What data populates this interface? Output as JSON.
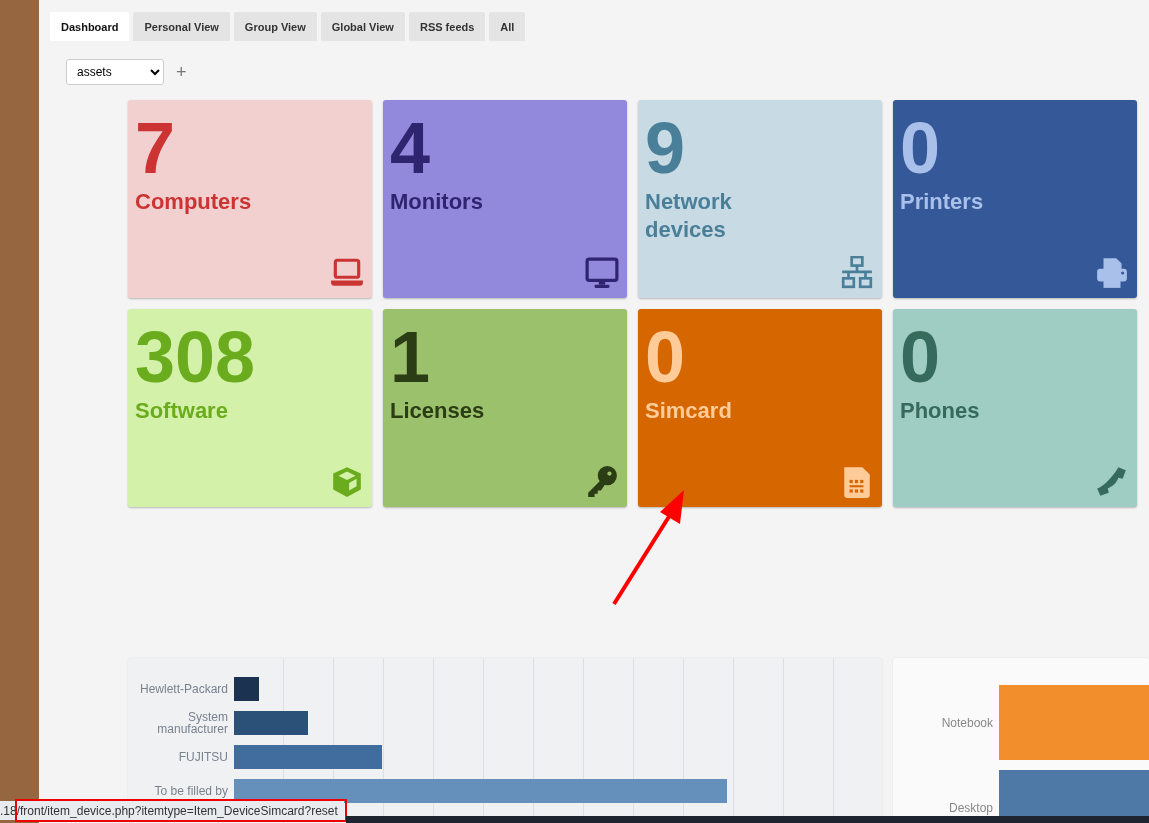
{
  "tabs": [
    {
      "label": "Dashboard",
      "selected": true
    },
    {
      "label": "Personal View",
      "selected": false
    },
    {
      "label": "Group View",
      "selected": false
    },
    {
      "label": "Global View",
      "selected": false
    },
    {
      "label": "RSS feeds",
      "selected": false
    },
    {
      "label": "All",
      "selected": false
    }
  ],
  "dashboard_select": {
    "value": "assets"
  },
  "add_button": "+",
  "tiles": [
    {
      "count": "7",
      "label": "Computers",
      "kind": "laptop",
      "color": "#f2d0d0"
    },
    {
      "count": "4",
      "label": "Monitors",
      "kind": "monitor",
      "color": "#9389dc"
    },
    {
      "count": "9",
      "label": "Network devices",
      "kind": "network",
      "color": "#c8dae3"
    },
    {
      "count": "0",
      "label": "Printers",
      "kind": "printer",
      "color": "#355898"
    },
    {
      "count": "308",
      "label": "Software",
      "kind": "box",
      "color": "#d3f1a8"
    },
    {
      "count": "1",
      "label": "Licenses",
      "kind": "key",
      "color": "#9cc16c"
    },
    {
      "count": "0",
      "label": "Simcard",
      "kind": "simcard",
      "color": "#d56600"
    },
    {
      "count": "0",
      "label": "Phones",
      "kind": "phone",
      "color": "#a0cdc3"
    }
  ],
  "manufacturer_chart": {
    "labels": [
      "Hewlett-Packard",
      "System manufacturer",
      "FUJITSU",
      "To be filled by"
    ]
  },
  "type_chart": {
    "labels": [
      "Notebook",
      "Desktop"
    ]
  },
  "status_bar": ".18/front/item_device.php?itemtype=Item_DeviceSimcard?reset"
}
